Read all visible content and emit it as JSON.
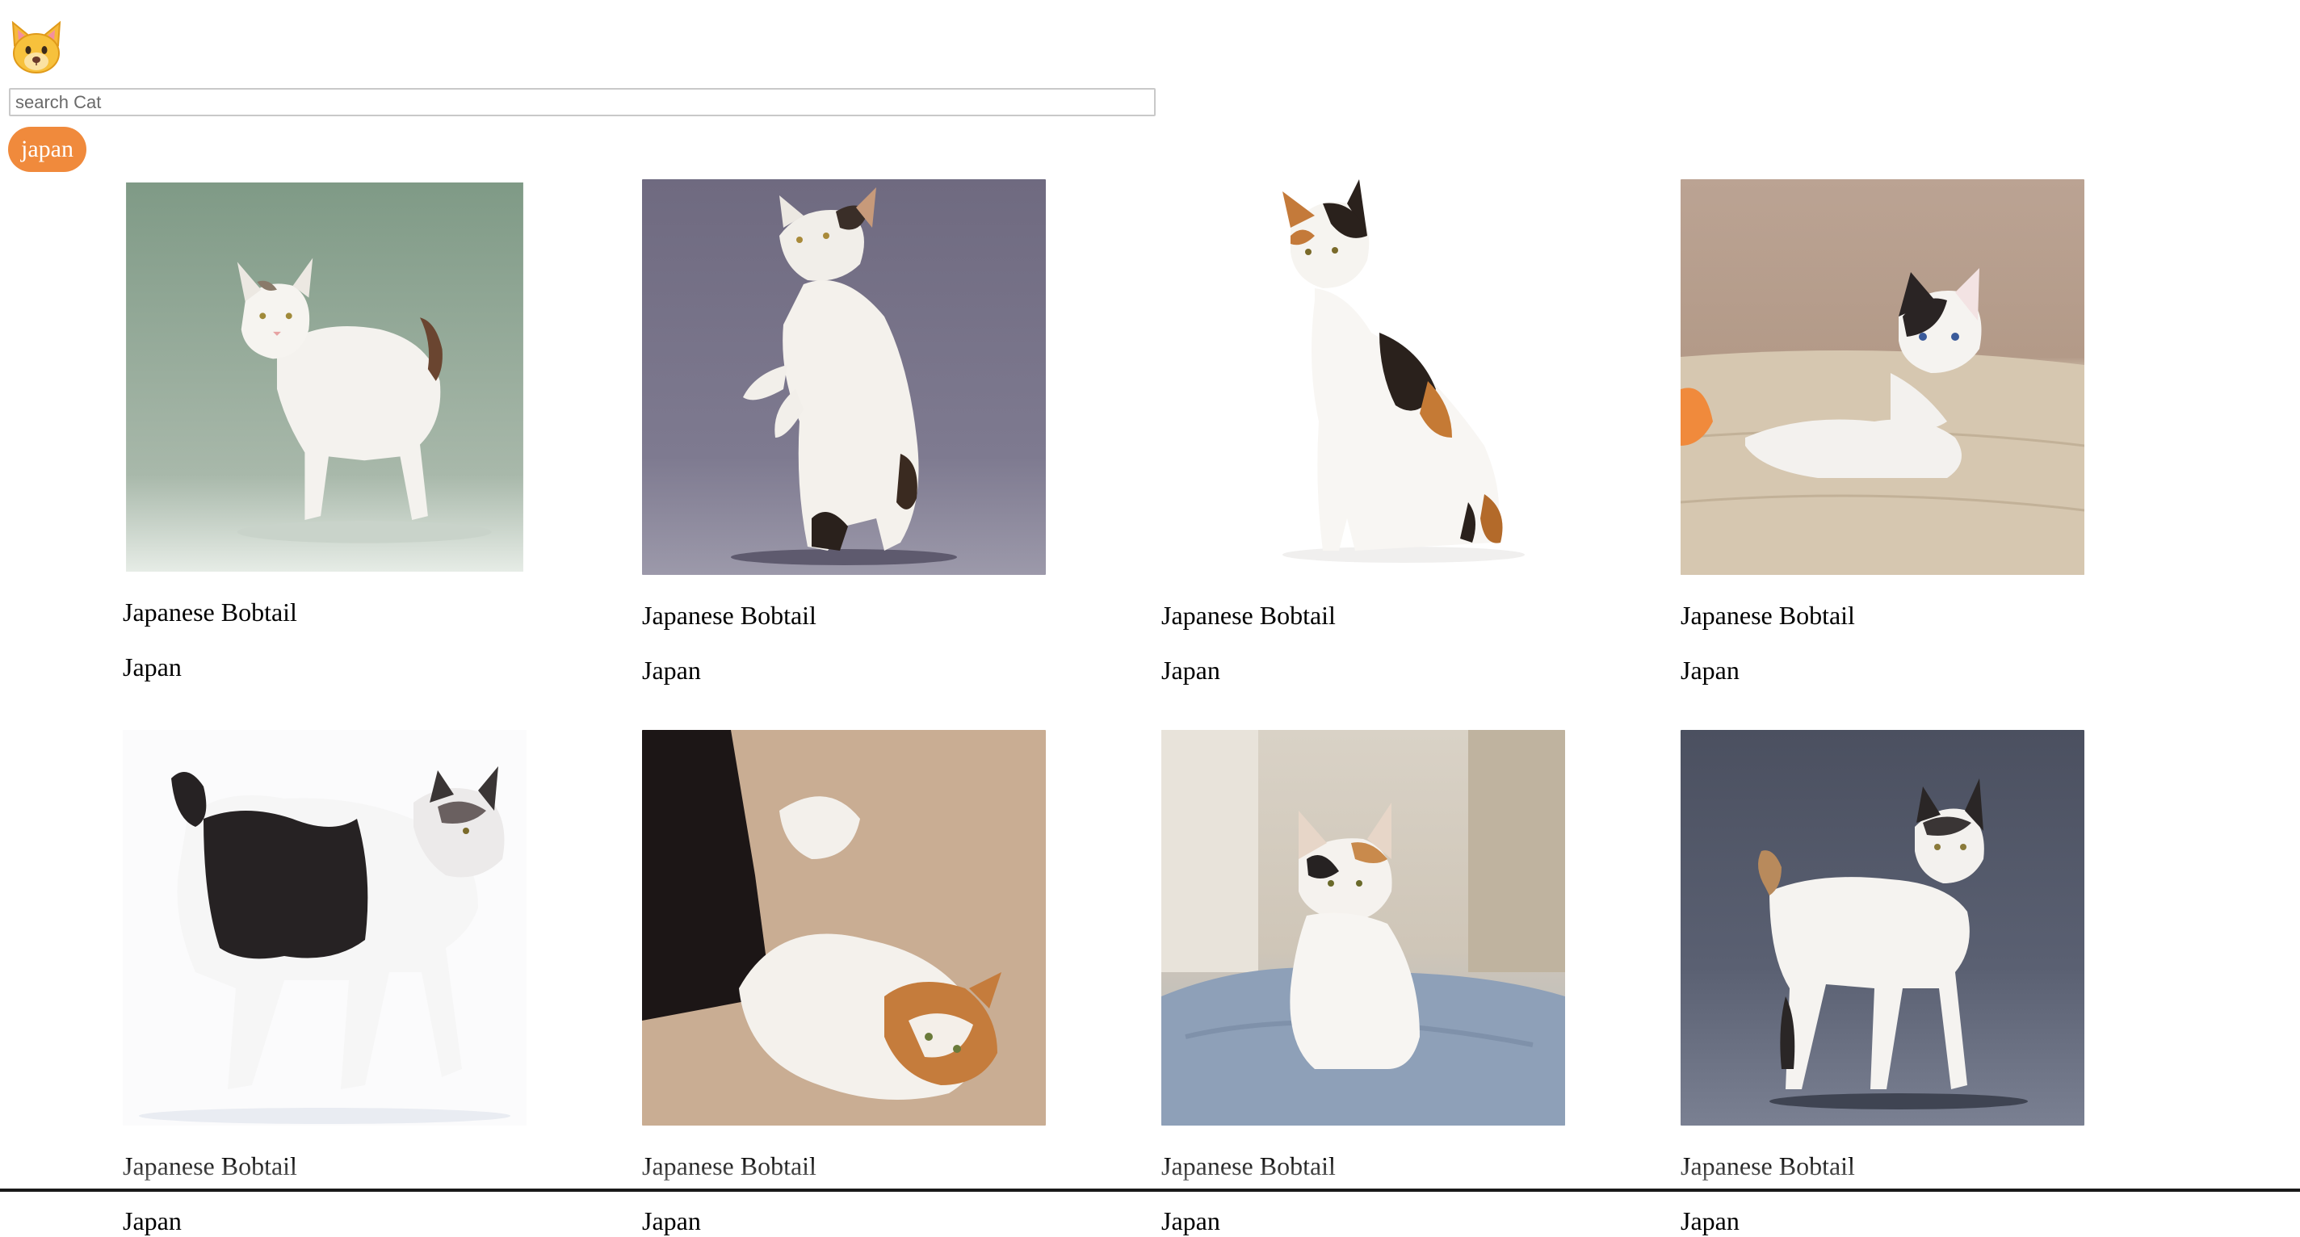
{
  "header": {
    "logo_icon": "cat-face-icon",
    "search": {
      "placeholder": "search Cat",
      "value": ""
    },
    "filter_chip": {
      "label": "japan",
      "color": "#f08a3c"
    }
  },
  "cards": [
    {
      "name": "Japanese Bobtail",
      "origin": "Japan",
      "photo": "white-cat-standing-green-backdrop"
    },
    {
      "name": "Japanese Bobtail",
      "origin": "Japan",
      "photo": "white-cat-rearing-on-hind-legs"
    },
    {
      "name": "Japanese Bobtail",
      "origin": "Japan",
      "photo": "calico-cat-sitting-white-backdrop"
    },
    {
      "name": "Japanese Bobtail",
      "origin": "Japan",
      "photo": "kitten-lying-on-sofa"
    },
    {
      "name": "Japanese Bobtail",
      "origin": "Japan",
      "photo": "black-white-cat-walking"
    },
    {
      "name": "Japanese Bobtail",
      "origin": "Japan",
      "photo": "cat-lying-on-carpet"
    },
    {
      "name": "Japanese Bobtail",
      "origin": "Japan",
      "photo": "calico-cat-sitting-on-blanket"
    },
    {
      "name": "Japanese Bobtail",
      "origin": "Japan",
      "photo": "white-cat-standing-grey-backdrop"
    }
  ]
}
